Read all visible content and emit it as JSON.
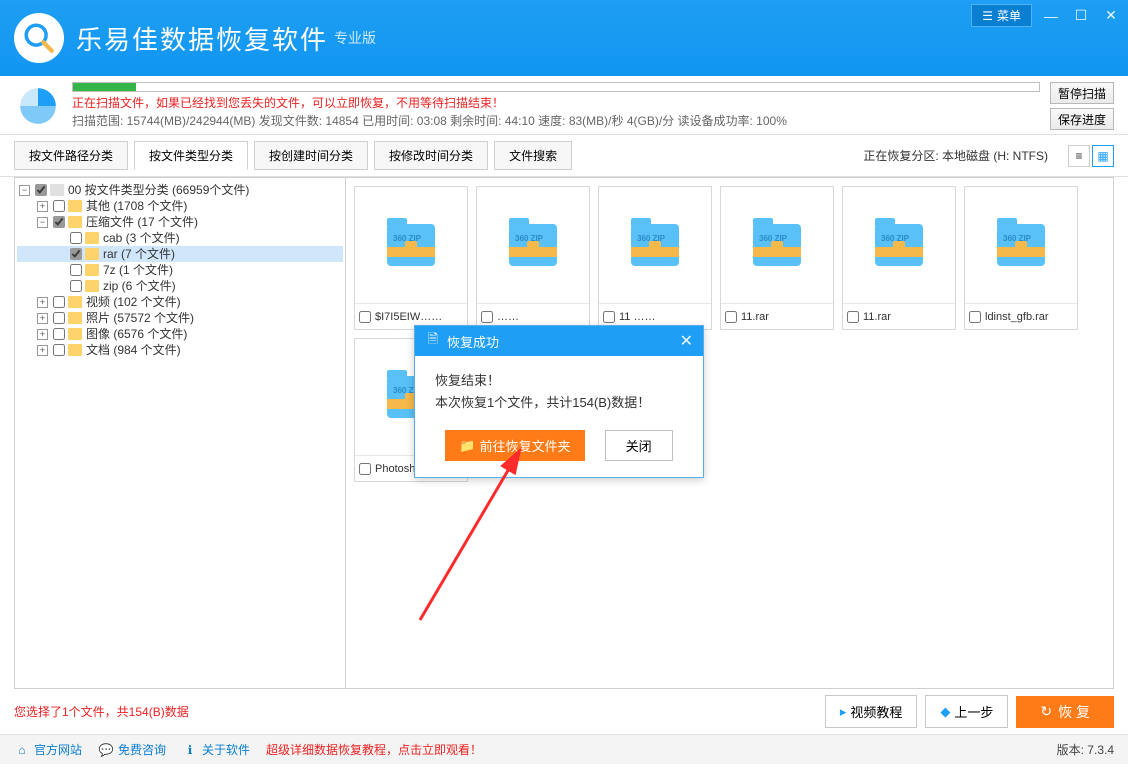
{
  "app": {
    "title": "乐易佳数据恢复软件",
    "edition": "专业版",
    "menu_label": "菜单"
  },
  "scan": {
    "warning": "正在扫描文件，如果已经找到您丢失的文件，可以立即恢复，不用等待扫描结束！",
    "stats": "扫描范围: 15744(MB)/242944(MB)   发现文件数: 14854   已用时间: 03:08   剩余时间: 44:10   速度: 83(MB)/秒 4(GB)/分 读设备成功率: 100%",
    "pause_label": "暂停扫描",
    "save_label": "保存进度"
  },
  "tabs": {
    "items": [
      "按文件路径分类",
      "按文件类型分类",
      "按创建时间分类",
      "按修改时间分类",
      "文件搜索"
    ],
    "partition": "正在恢复分区: 本地磁盘 (H: NTFS)"
  },
  "tree": {
    "root": "00 按文件类型分类    (66959个文件)",
    "other": "其他    (1708 个文件)",
    "archive": "压缩文件    (17 个文件)",
    "cab": "cab    (3 个文件)",
    "rar": "rar    (7 个文件)",
    "sevenz": "7z    (1 个文件)",
    "zip": "zip    (6 个文件)",
    "video": "视频    (102 个文件)",
    "photo": "照片    (57572 个文件)",
    "image": "图像    (6576 个文件)",
    "doc": "文档    (984 个文件)"
  },
  "files": {
    "zip_badge": "360\nZIP",
    "items": [
      "$I7I5EIW……",
      "……",
      "11 ……",
      "11.rar",
      "11.rar",
      "ldinst_gfb.rar",
      "Photoshop CS6.rar"
    ]
  },
  "dialog": {
    "title": "恢复成功",
    "line1": "恢复结束！",
    "line2": "本次恢复1个文件，共计154(B)数据！",
    "primary": "前往恢复文件夹",
    "close": "关闭"
  },
  "footer": {
    "selection": "您选择了1个文件，共154(B)数据",
    "video": "视频教程",
    "prev": "上一步",
    "recover": "恢 复"
  },
  "bottom": {
    "site": "官方网站",
    "consult": "免费咨询",
    "about": "关于软件",
    "tutorial": "超级详细数据恢复教程，点击立即观看！",
    "version": "版本: 7.3.4"
  }
}
